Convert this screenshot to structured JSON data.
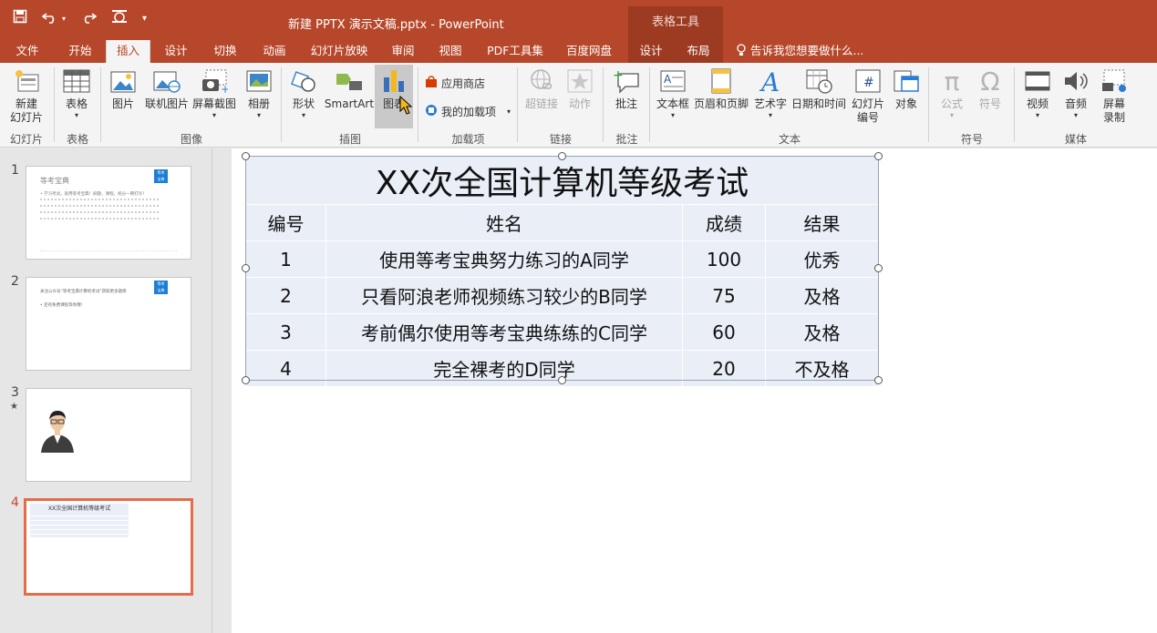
{
  "titlebar": {
    "doc_title": "新建 PPTX 演示文稿.pptx - PowerPoint",
    "context_tools": "表格工具",
    "qat": [
      "save-icon",
      "undo-icon",
      "redo-icon",
      "touch-mode-icon",
      "customize-icon"
    ]
  },
  "tabs": [
    {
      "label": "文件"
    },
    {
      "label": "开始"
    },
    {
      "label": "插入"
    },
    {
      "label": "设计"
    },
    {
      "label": "切换"
    },
    {
      "label": "动画"
    },
    {
      "label": "幻灯片放映"
    },
    {
      "label": "审阅"
    },
    {
      "label": "视图"
    },
    {
      "label": "PDF工具集"
    },
    {
      "label": "百度网盘"
    },
    {
      "label": "设计"
    },
    {
      "label": "布局"
    }
  ],
  "tellme": "告诉我您想要做什么...",
  "ribbon": {
    "new_slide": "新建\n幻灯片",
    "table": "表格",
    "picture": "图片",
    "online_picture": "联机图片",
    "screenshot": "屏幕截图",
    "album": "相册",
    "shapes": "形状",
    "smartart": "SmartArt",
    "chart": "图表",
    "store": "应用商店",
    "my_addins": "我的加载项",
    "hyperlink": "超链接",
    "action": "动作",
    "comment": "批注",
    "textbox": "文本框",
    "header_footer": "页眉和页脚",
    "wordart": "艺术字",
    "datetime": "日期和时间",
    "slide_number": "幻灯片\n编号",
    "object": "对象",
    "equation": "公式",
    "symbol": "符号",
    "video": "视频",
    "audio": "音频",
    "screen_record": "屏幕\n录制",
    "groups": {
      "slides": "幻灯片",
      "tables": "表格",
      "images": "图像",
      "illustrations": "插图",
      "addins": "加载项",
      "links": "链接",
      "comments": "批注",
      "text": "文本",
      "symbols": "符号",
      "media": "媒体"
    }
  },
  "slides": [
    {
      "num": "1"
    },
    {
      "num": "2"
    },
    {
      "num": "3"
    },
    {
      "num": "4"
    }
  ],
  "slide1": {
    "title": "等考宝典",
    "badge": "等考\n宝典",
    "bullet": "• 学习考试，就用等考宝典！刷题，课程，统分一网打尽！"
  },
  "slide2": {
    "line1": "关注公众号“等考宝典计算机考试”获取更多题库",
    "line2": "• 还有免费课程等你哦！",
    "badge": "等考\n宝典"
  },
  "slide3_marker": "★",
  "table": {
    "title": "XX次全国计算机等级考试",
    "headers": [
      "编号",
      "姓名",
      "成绩",
      "结果"
    ],
    "rows": [
      [
        "1",
        "使用等考宝典努力练习的A同学",
        "100",
        "优秀"
      ],
      [
        "2",
        "只看阿浪老师视频练习较少的B同学",
        "75",
        "及格"
      ],
      [
        "3",
        "考前偶尔使用等考宝典练练的C同学",
        "60",
        "及格"
      ],
      [
        "4",
        "完全裸考的D同学",
        "20",
        "不及格"
      ]
    ]
  }
}
